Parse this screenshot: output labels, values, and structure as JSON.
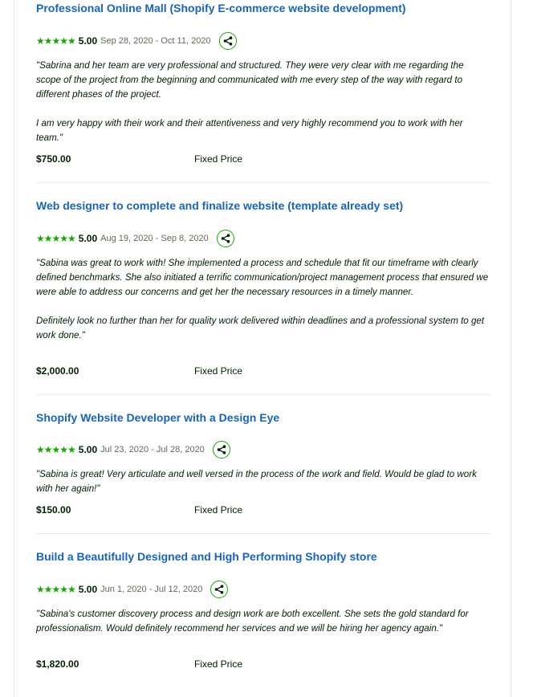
{
  "reviews": [
    {
      "title": "Professional Online Mall (Shopify E-commerce website development)",
      "stars": "★★★★★",
      "score": "5.00",
      "dates": "Sep 28, 2020 - Oct 11, 2020",
      "quote": [
        "\"Sabrina and her team are very professional and structured. They were very clear with me regarding the scope of the project from the beginning and communicated with me every step of the way with regard to different phases of the project.",
        "I am very happy with their work and their attentiveness and very highly recommend you to work with her team.\""
      ],
      "price": "$750.00",
      "price_type": "Fixed Price"
    },
    {
      "title": "Web designer to complete and finalize website (template already set)",
      "stars": "★★★★★",
      "score": "5.00",
      "dates": "Aug 19, 2020 - Sep 8, 2020",
      "quote": [
        "\"Sabina was great to work with! She implemented a process and schedule that fit our timeframe with clearly defined benchmarks. She also initiated a terrific communication/project management process that ensured we were able to address our concerns and get her the necessary resources in a timely manner.",
        "Definitely look no further than her for quality work delivered within deadlines and a professional system to get work done.\""
      ],
      "price": "$2,000.00",
      "price_type": "Fixed Price"
    },
    {
      "title": "Shopify Website Developer with a Design Eye",
      "stars": "★★★★★",
      "score": "5.00",
      "dates": "Jul 23, 2020 - Jul 28, 2020",
      "quote": [
        "\"Sabina is great! Very articulate and well versed in the process of the work and field. Would be glad to work with her again!\""
      ],
      "price": "$150.00",
      "price_type": "Fixed Price"
    },
    {
      "title": "Build a Beautifully Designed and High Performing Shopify store",
      "stars": "★★★★★",
      "score": "5.00",
      "dates": "Jun 1, 2020 - Jul 12, 2020",
      "quote": [
        "\"Sabina's customer discovery process and design work are both excellent. She sets the gold standard for professionalism. Would definitely recommend her services and we will be hiring her agency again.\""
      ],
      "price": "$1,820.00",
      "price_type": "Fixed Price"
    }
  ],
  "icons": {
    "share": "share-icon",
    "star": "star-icon"
  },
  "colors": {
    "accent": "#14a800",
    "link": "#1864c0",
    "divider": "#e4ebe4"
  }
}
